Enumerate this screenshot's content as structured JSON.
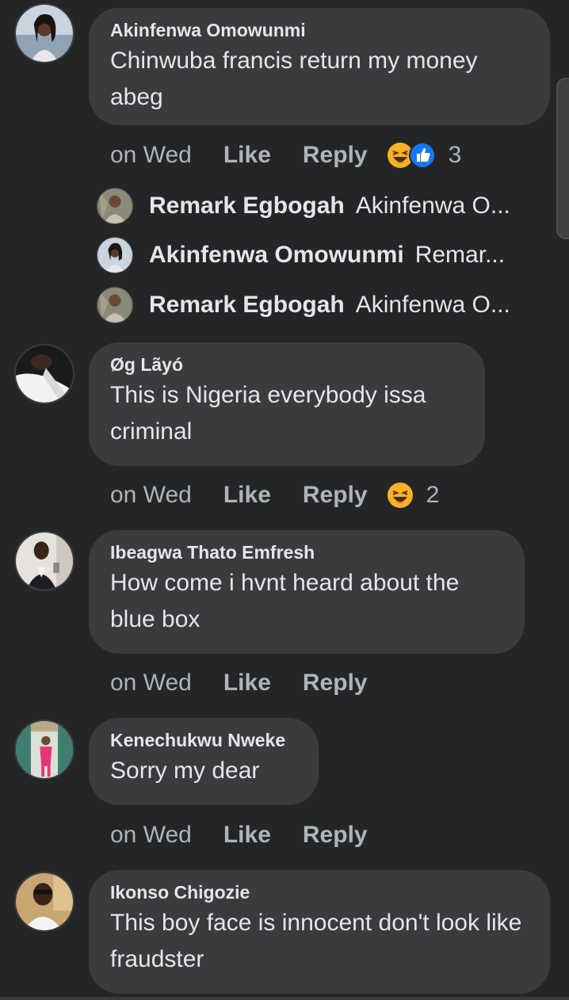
{
  "comments": [
    {
      "author": "Akinfenwa Omowunmi",
      "text": "Chinwuba francis return my money abeg",
      "time": "on Wed",
      "like": "Like",
      "reply": "Reply",
      "reaction_count": "3",
      "reaction_icons": [
        "haha-icon",
        "like-icon"
      ]
    },
    {
      "author": "Øg Lãyó",
      "text": "This is Nigeria everybody issa criminal",
      "time": "on Wed",
      "like": "Like",
      "reply": "Reply",
      "reaction_count": "2",
      "reaction_icons": [
        "haha-icon"
      ]
    },
    {
      "author": "Ibeagwa Thato Emfresh",
      "text": "How come i hvnt heard about the blue box",
      "time": "on Wed",
      "like": "Like",
      "reply": "Reply"
    },
    {
      "author": "Kenechukwu Nweke",
      "text": "Sorry my dear",
      "time": "on Wed",
      "like": "Like",
      "reply": "Reply"
    },
    {
      "author": "Ikonso Chigozie",
      "text": "This boy face is innocent don't look like fraudster"
    }
  ],
  "replies": [
    {
      "name": "Remark Egbogah",
      "preview": "Akinfenwa O..."
    },
    {
      "name": "Akinfenwa Omowunmi",
      "preview": "Remar..."
    },
    {
      "name": "Remark Egbogah",
      "preview": "Akinfenwa O..."
    }
  ],
  "colors": {
    "background": "#242526",
    "bubble": "#3a3b3c",
    "text_primary": "#e4e6eb",
    "text_secondary": "#b0b3b8",
    "like_blue": "#1877f2",
    "haha_yellow": "#f7b125"
  }
}
